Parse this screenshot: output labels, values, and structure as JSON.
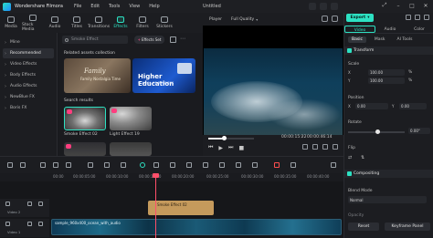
{
  "app": {
    "name": "Wondershare Filmora",
    "menu": [
      "File",
      "Edit",
      "Tools",
      "View",
      "Help"
    ],
    "document_title": "Untitled"
  },
  "media_tabs": [
    {
      "label": "Media",
      "icon": "media-icon"
    },
    {
      "label": "Stock Media",
      "icon": "stock-media-icon"
    },
    {
      "label": "Audio",
      "icon": "audio-icon"
    },
    {
      "label": "Titles",
      "icon": "titles-icon"
    },
    {
      "label": "Transitions",
      "icon": "transitions-icon"
    },
    {
      "label": "Effects",
      "icon": "effects-icon",
      "active": true
    },
    {
      "label": "Filters",
      "icon": "filters-icon"
    },
    {
      "label": "Stickers",
      "icon": "stickers-icon"
    }
  ],
  "sidebar": {
    "items": [
      {
        "label": "Mine"
      },
      {
        "label": "Recommended",
        "active": true
      },
      {
        "label": "Video Effects"
      },
      {
        "label": "Body Effects"
      },
      {
        "label": "Audio Effects"
      },
      {
        "label": "NewBlue FX"
      },
      {
        "label": "Boris FX"
      }
    ]
  },
  "browser": {
    "search_placeholder": "Smoke Effect",
    "chip_label": "Effects Set",
    "collection_heading": "Related assets collection",
    "card_family_title": "Family",
    "card_family_subtitle": "Family Nostalgia Time",
    "card_edu_title": "Higher Education",
    "card_edu_subtitle": "SCHOOL OF BUSINESS",
    "results_heading": "Search results",
    "results": [
      "Smoke Effect 02",
      "Light Effect 19"
    ]
  },
  "player": {
    "label": "Player",
    "quality": "Full Quality",
    "current_time": "00:00:15:22",
    "total_time": "00:00:46:14",
    "progress": 0.34
  },
  "right_panel": {
    "export_label": "Export",
    "tabs": [
      {
        "label": "Video",
        "active": true
      },
      {
        "label": "Audio"
      },
      {
        "label": "Color"
      }
    ],
    "subtabs": [
      {
        "label": "Basic",
        "active": true
      },
      {
        "label": "Mask"
      },
      {
        "label": "AI Tools"
      }
    ],
    "transform_label": "Transform",
    "scale_label": "Scale",
    "scale_x": "100.00",
    "scale_y": "100.00",
    "scale_unit": "%",
    "position_label": "Position",
    "position_x": "0.00",
    "position_y": "0.00",
    "rotate_label": "Rotate",
    "rotate_value": "0.00°",
    "flip_label": "Flip",
    "compositing_label": "Compositing",
    "blend_label": "Blend Mode",
    "blend_value": "Normal",
    "opacity_label": "Opacity",
    "reset_label": "Reset",
    "keyframe_label": "Keyframe Panel"
  },
  "timeline": {
    "ruler": [
      "00:00",
      "00:00:05:00",
      "00:00:10:00",
      "00:00:15:00",
      "00:00:20:00",
      "00:00:25:00",
      "00:00:30:00",
      "00:00:35:00",
      "00:00:40:00"
    ],
    "track2_label": "Video 2",
    "track1_label": "Video 1",
    "clip_smoke": "Smoke Effect 02",
    "clip_video": "sample_960x400_ocean_with_audio"
  },
  "colors": {
    "accent": "#2de1c2",
    "playhead": "#ff4f6a",
    "favorite": "#ff3d7f"
  }
}
